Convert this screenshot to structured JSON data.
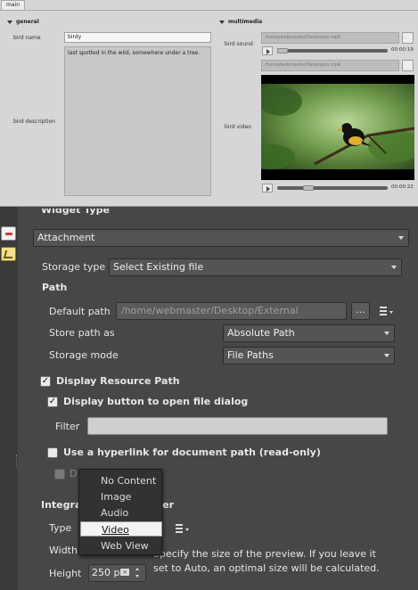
{
  "form_preview": {
    "tab_label": "main",
    "general": {
      "title": "general",
      "bird_name_label": "bird name",
      "bird_name_value": "birdy",
      "bird_description_label": "bird description",
      "bird_description_value": "last spotted in the wild, somewhere under a tree."
    },
    "multimedia": {
      "title": "multimedia",
      "bird_sound_label": "bird sound",
      "bird_sound_path": "/home/webmaster/Desktop/s.mp3",
      "bird_sound_time": "00:00:19",
      "bird_video_path": "/home/webmaster/Desktop/s.mp4",
      "bird_video_label": "bird video",
      "bird_video_time": "00:00:22"
    }
  },
  "settings": {
    "widget_type_heading": "Widget Type",
    "widget_type_value": "Attachment",
    "storage_type_label": "Storage type",
    "storage_type_value": "Select Existing file",
    "path_heading": "Path",
    "default_path_label": "Default path",
    "default_path_value": "/home/webmaster/Desktop/External",
    "browse_button": "...",
    "store_path_as_label": "Store path as",
    "store_path_as_value": "Absolute Path",
    "storage_mode_label": "Storage mode",
    "storage_mode_value": "File Paths",
    "display_resource_path_label": "Display Resource Path",
    "display_button_label": "Display button to open file dialog",
    "filter_label": "Filter",
    "filter_value": "",
    "use_hyperlink_label": "Use a hyperlink for document path (read-only)",
    "disabled_option_label": "D",
    "integrated_viewer_heading_start": "Integra",
    "integrated_viewer_heading_end": "ver",
    "type_label": "Type",
    "width_label": "Width",
    "height_label": "Height",
    "height_value": "250 p",
    "preview_help_line1": "Specify the size of the preview. If you leave it",
    "preview_help_line2": "set to Auto, an optimal size will be calculated."
  },
  "viewer_type_popup": {
    "items": [
      "No Content",
      "Image",
      "Audio",
      "Video",
      "Web View"
    ],
    "selected": "Video"
  },
  "icons": [
    "expand-arrow-icon",
    "play-icon",
    "clear-field-icon",
    "expression-icon",
    "remove-icon",
    "edit-icon",
    "checkmark-icon",
    "chevron-down-icon",
    "spin-up-icon",
    "spin-down-icon"
  ],
  "colors": {
    "panel_background": "#474747",
    "preview_background": "#d6d6d6",
    "popup_background": "#323232"
  }
}
